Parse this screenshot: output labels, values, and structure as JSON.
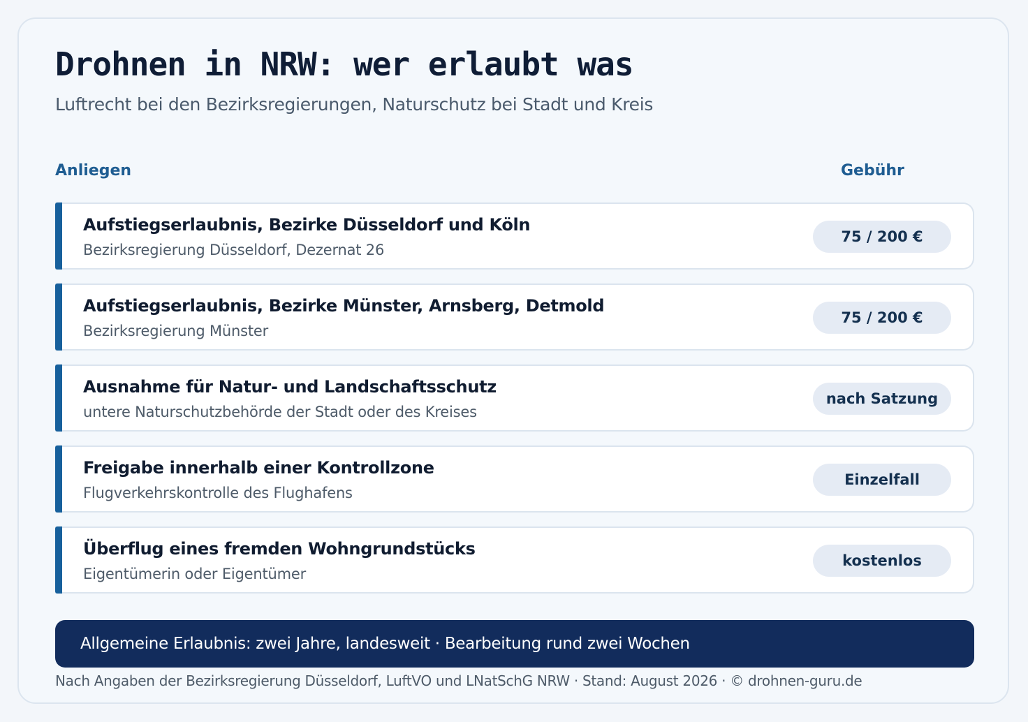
{
  "header": {
    "title": "Drohnen in NRW: wer erlaubt was",
    "subtitle": "Luftrecht bei den Bezirksregierungen, Naturschutz bei Stadt und Kreis"
  },
  "columns": {
    "left": "Anliegen",
    "right": "Gebühr"
  },
  "rows": [
    {
      "name": "Aufstiegserlaubnis, Bezirke Düsseldorf und Köln",
      "authority": "Bezirksregierung Düsseldorf, Dezernat 26",
      "fee": "75 / 200 €"
    },
    {
      "name": "Aufstiegserlaubnis, Bezirke Münster, Arnsberg, Detmold",
      "authority": "Bezirksregierung Münster",
      "fee": "75 / 200 €"
    },
    {
      "name": "Ausnahme für Natur- und Landschaftsschutz",
      "authority": "untere Naturschutzbehörde der Stadt oder des Kreises",
      "fee": "nach Satzung"
    },
    {
      "name": "Freigabe innerhalb einer Kontrollzone",
      "authority": "Flugverkehrskontrolle des Flughafens",
      "fee": "Einzelfall"
    },
    {
      "name": "Überflug eines fremden Wohngrundstücks",
      "authority": "Eigentümerin oder Eigentümer",
      "fee": "kostenlos"
    }
  ],
  "banner": "Allgemeine Erlaubnis: zwei Jahre, landesweit · Bearbeitung rund zwei Wochen",
  "footer": "Nach Angaben der Bezirksregierung Düsseldorf, LuftVO und LNatSchG NRW · Stand: August 2026 · © drohnen-guru.de",
  "colors": {
    "accent": "#17609c",
    "banner": "#122c5c",
    "title": "#0f1d36",
    "fee_pill": "#e5ebf4"
  }
}
